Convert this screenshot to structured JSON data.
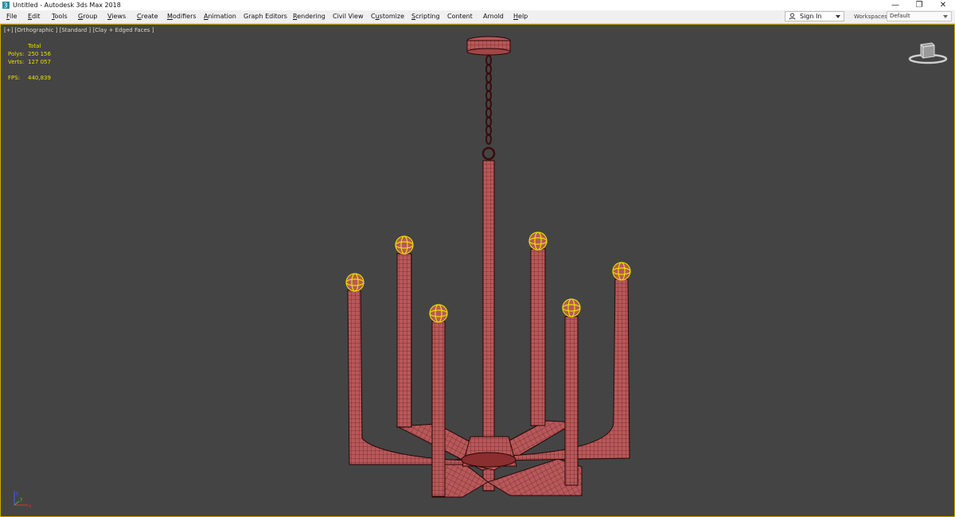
{
  "window": {
    "title": "Untitled - Autodesk 3ds Max 2018",
    "app_icon": "3dsmax-icon"
  },
  "window_controls": {
    "minimize": "—",
    "restore": "❐",
    "close": "✕"
  },
  "menu": [
    {
      "label": "File",
      "underline": "F"
    },
    {
      "label": "Edit",
      "underline": "E"
    },
    {
      "label": "Tools",
      "underline": "T"
    },
    {
      "label": "Group",
      "underline": "G"
    },
    {
      "label": "Views",
      "underline": "V"
    },
    {
      "label": "Create",
      "underline": "C"
    },
    {
      "label": "Modifiers",
      "underline": "M"
    },
    {
      "label": "Animation",
      "underline": "A"
    },
    {
      "label": "Graph Editors",
      "underline": ""
    },
    {
      "label": "Rendering",
      "underline": "R"
    },
    {
      "label": "Civil View",
      "underline": ""
    },
    {
      "label": "Customize",
      "underline": "u"
    },
    {
      "label": "Scripting",
      "underline": "S"
    },
    {
      "label": "Content",
      "underline": ""
    },
    {
      "label": "Arnold",
      "underline": ""
    },
    {
      "label": "Help",
      "underline": "H"
    }
  ],
  "signin": {
    "label": "Sign In"
  },
  "workspaces": {
    "label": "Workspaces:",
    "value": "Default"
  },
  "viewport": {
    "label": "[+] [Orthographic ] [Standard ] [Clay + Edged Faces ]",
    "stats": {
      "header": "Total",
      "polys_label": "Polys:",
      "polys_value": "250 156",
      "verts_label": "Verts:",
      "verts_value": "127 057",
      "fps_label": "FPS:",
      "fps_value": "440,839"
    },
    "axis": {
      "x": "x",
      "y": "y",
      "z": "z"
    }
  },
  "colors": {
    "viewport_bg": "#444444",
    "model_fill": "#b8585a",
    "model_wire": "#3a0c0c",
    "selection": "#e8e000",
    "axis_x": "#e03030",
    "axis_y": "#30c030",
    "axis_z": "#4060ff"
  }
}
